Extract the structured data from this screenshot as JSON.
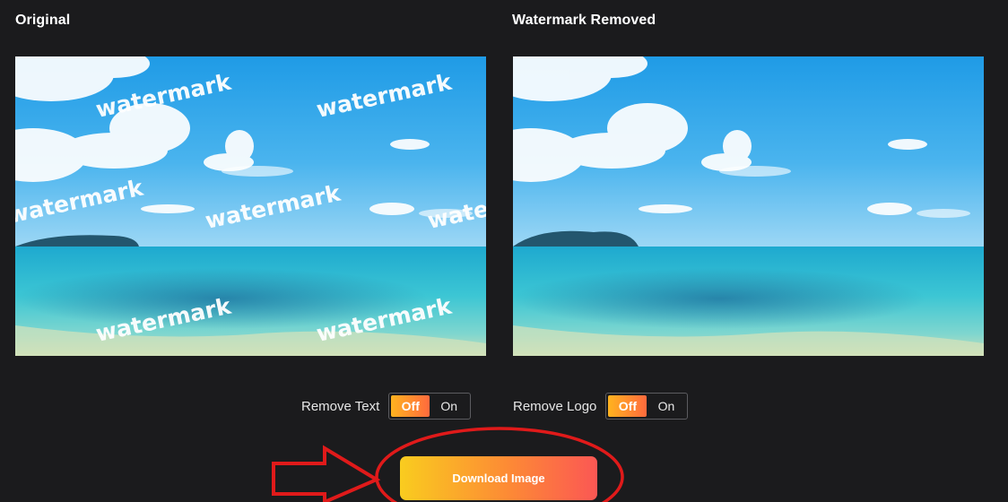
{
  "panels": {
    "original_title": "Original",
    "removed_title": "Watermark Removed",
    "watermark_text": "watermark"
  },
  "controls": {
    "remove_text": {
      "label": "Remove Text",
      "off_label": "Off",
      "on_label": "On",
      "state": "Off"
    },
    "remove_logo": {
      "label": "Remove Logo",
      "off_label": "Off",
      "on_label": "On",
      "state": "Off"
    }
  },
  "download": {
    "label": "Download Image"
  },
  "colors": {
    "background": "#1b1b1d",
    "accent_start": "#f9cc1f",
    "accent_end": "#fb5754",
    "annotation": "#e01a1a"
  }
}
